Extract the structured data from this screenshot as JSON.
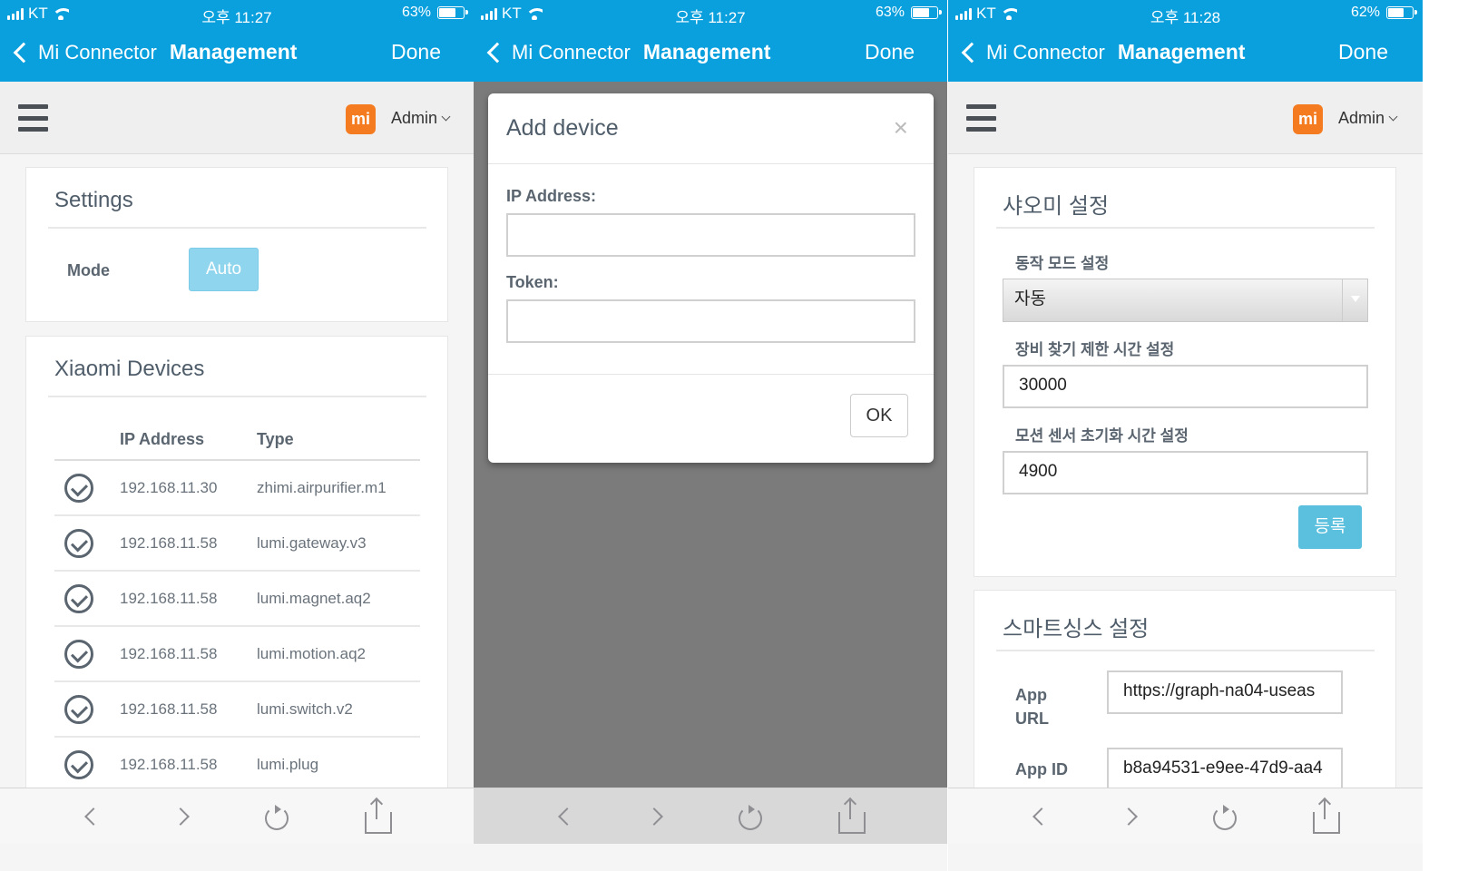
{
  "status_1": {
    "carrier": "KT",
    "time": "오후 11:27",
    "battery": "63%",
    "battery_level": 0.63
  },
  "status_2": {
    "carrier": "KT",
    "time": "오후 11:27",
    "battery": "63%",
    "battery_level": 0.63
  },
  "status_3": {
    "carrier": "KT",
    "time": "오후 11:28",
    "battery": "62%",
    "battery_level": 0.62
  },
  "nav": {
    "back_label": "Mi Connector",
    "title": "Management",
    "done_label": "Done"
  },
  "header": {
    "logo_text": "mi",
    "user_label": "Admin"
  },
  "settings": {
    "title": "Settings",
    "mode_label": "Mode",
    "mode_button": "Auto"
  },
  "devices": {
    "title": "Xiaomi Devices",
    "columns": [
      "IP Address",
      "Type"
    ],
    "rows": [
      {
        "ip": "192.168.11.30",
        "type": "zhimi.airpurifier.m1"
      },
      {
        "ip": "192.168.11.58",
        "type": "lumi.gateway.v3"
      },
      {
        "ip": "192.168.11.58",
        "type": "lumi.magnet.aq2"
      },
      {
        "ip": "192.168.11.58",
        "type": "lumi.motion.aq2"
      },
      {
        "ip": "192.168.11.58",
        "type": "lumi.switch.v2"
      },
      {
        "ip": "192.168.11.58",
        "type": "lumi.plug"
      }
    ]
  },
  "modal": {
    "title": "Add device",
    "close_glyph": "×",
    "ip_label": "IP Address:",
    "ip_value": "",
    "token_label": "Token:",
    "token_value": "",
    "ok_label": "OK"
  },
  "xiaomi_settings": {
    "title": "샤오미 설정",
    "mode_label": "동작 모드 설정",
    "mode_value": "자동",
    "search_label": "장비 찾기 제한 시간 설정",
    "search_value": "30000",
    "motion_label": "모션 센서 초기화 시간 설정",
    "motion_value": "4900",
    "register_button": "등록"
  },
  "smartthings_settings": {
    "title": "스마트싱스 설정",
    "app_url_label": "App URL",
    "app_url_value": "https://graph-na04-useas",
    "app_id_label": "App ID",
    "app_id_value": "b8a94531-e9ee-47d9-aa4"
  },
  "colors": {
    "nav_blue": "#0aa0de",
    "mi_orange": "#f47b20",
    "overlay_gray": "#7b7b7b",
    "button_blue": "#5bc0de"
  },
  "icons": [
    "signal-icon",
    "wifi-icon",
    "battery-icon",
    "back-chevron-icon",
    "hamburger-menu-icon",
    "mi-logo-icon",
    "chevron-down-icon",
    "check-circle-icon",
    "close-icon",
    "dropdown-arrow-icon",
    "browser-back-icon",
    "browser-forward-icon",
    "reload-icon",
    "share-icon"
  ]
}
